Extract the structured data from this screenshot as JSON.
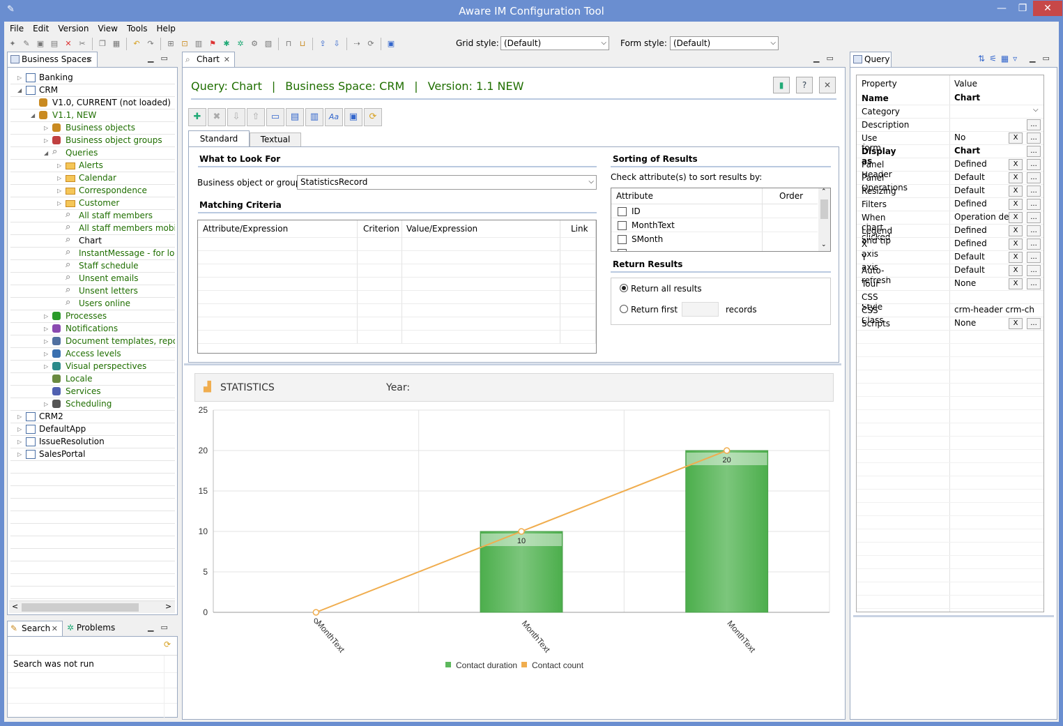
{
  "window": {
    "title": "Aware IM Configuration Tool"
  },
  "menu": [
    "File",
    "Edit",
    "Version",
    "View",
    "Tools",
    "Help"
  ],
  "toolbar": {
    "grid_style_label": "Grid style:",
    "grid_style_value": "(Default)",
    "form_style_label": "Form style:",
    "form_style_value": "(Default)"
  },
  "left_panel": {
    "tab": "Business Spaces",
    "tree": [
      {
        "label": "Banking",
        "level": 0,
        "tw": "▷",
        "green": false,
        "icon": "space"
      },
      {
        "label": "CRM",
        "level": 0,
        "tw": "◢",
        "green": false,
        "icon": "space"
      },
      {
        "label": "V1.0, CURRENT (not loaded)",
        "level": 1,
        "tw": "",
        "green": false,
        "icon": "version"
      },
      {
        "label": "V1.1, NEW",
        "level": 1,
        "tw": "◢",
        "green": true,
        "icon": "version"
      },
      {
        "label": "Business objects",
        "level": 2,
        "tw": "▷",
        "green": true,
        "icon": "bo"
      },
      {
        "label": "Business object groups",
        "level": 2,
        "tw": "▷",
        "green": true,
        "icon": "bog"
      },
      {
        "label": "Queries",
        "level": 2,
        "tw": "◢",
        "green": true,
        "icon": "query"
      },
      {
        "label": "Alerts",
        "level": 3,
        "tw": "▷",
        "green": true,
        "icon": "folder"
      },
      {
        "label": "Calendar",
        "level": 3,
        "tw": "▷",
        "green": true,
        "icon": "folder"
      },
      {
        "label": "Correspondence",
        "level": 3,
        "tw": "▷",
        "green": true,
        "icon": "folder"
      },
      {
        "label": "Customer",
        "level": 3,
        "tw": "▷",
        "green": true,
        "icon": "folder"
      },
      {
        "label": "All staff members",
        "level": 3,
        "tw": "",
        "green": true,
        "icon": "query"
      },
      {
        "label": "All staff members mobile",
        "level": 3,
        "tw": "",
        "green": true,
        "icon": "query"
      },
      {
        "label": "Chart",
        "level": 3,
        "tw": "",
        "green": false,
        "icon": "query"
      },
      {
        "label": "InstantMessage - for logged",
        "level": 3,
        "tw": "",
        "green": true,
        "icon": "query"
      },
      {
        "label": "Staff schedule",
        "level": 3,
        "tw": "",
        "green": true,
        "icon": "query"
      },
      {
        "label": "Unsent emails",
        "level": 3,
        "tw": "",
        "green": true,
        "icon": "query"
      },
      {
        "label": "Unsent letters",
        "level": 3,
        "tw": "",
        "green": true,
        "icon": "query"
      },
      {
        "label": "Users online",
        "level": 3,
        "tw": "",
        "green": true,
        "icon": "query"
      },
      {
        "label": "Processes",
        "level": 2,
        "tw": "▷",
        "green": true,
        "icon": "process"
      },
      {
        "label": "Notifications",
        "level": 2,
        "tw": "▷",
        "green": true,
        "icon": "notif"
      },
      {
        "label": "Document templates, reports",
        "level": 2,
        "tw": "▷",
        "green": true,
        "icon": "doc"
      },
      {
        "label": "Access levels",
        "level": 2,
        "tw": "▷",
        "green": true,
        "icon": "access"
      },
      {
        "label": "Visual perspectives",
        "level": 2,
        "tw": "▷",
        "green": true,
        "icon": "visual"
      },
      {
        "label": "Locale",
        "level": 2,
        "tw": "",
        "green": true,
        "icon": "locale"
      },
      {
        "label": "Services",
        "level": 2,
        "tw": "",
        "green": true,
        "icon": "services"
      },
      {
        "label": "Scheduling",
        "level": 2,
        "tw": "▷",
        "green": true,
        "icon": "sched"
      },
      {
        "label": "CRM2",
        "level": 0,
        "tw": "▷",
        "green": false,
        "icon": "space"
      },
      {
        "label": "DefaultApp",
        "level": 0,
        "tw": "▷",
        "green": false,
        "icon": "space"
      },
      {
        "label": "IssueResolution",
        "level": 0,
        "tw": "▷",
        "green": false,
        "icon": "space"
      },
      {
        "label": "SalesPortal",
        "level": 0,
        "tw": "▷",
        "green": false,
        "icon": "space"
      }
    ]
  },
  "search_panel": {
    "tab_search": "Search",
    "tab_problems": "Problems",
    "message": "Search was not run"
  },
  "editor": {
    "tab": "Chart",
    "header_query": "Query: Chart",
    "header_sep1": "|",
    "header_space": "Business Space: CRM",
    "header_sep2": "|",
    "header_version": "Version: 1.1 NEW",
    "view_tabs": [
      "Standard view",
      "Textual view"
    ],
    "what_to_look_for": "What to Look For",
    "bo_label": "Business object or group:",
    "bo_value": "StatisticsRecord",
    "matching_criteria": "Matching Criteria",
    "criteria_cols": [
      "Attribute/Expression",
      "Criterion",
      "Value/Expression",
      "Link"
    ],
    "sorting_title": "Sorting of Results",
    "sorting_hint": "Check attribute(s) to sort results by:",
    "sort_cols": [
      "Attribute",
      "Order"
    ],
    "sort_attrs": [
      "ID",
      "MonthText",
      "SMonth"
    ],
    "return_title": "Return Results",
    "return_all": "Return all results",
    "return_first": "Return first",
    "records": "records"
  },
  "preview": {
    "title": "STATISTICS",
    "year_label": "Year:"
  },
  "chart_data": {
    "type": "bar",
    "categories": [
      "MonthText",
      "MonthText",
      "MonthText"
    ],
    "series": [
      {
        "name": "Contact duration",
        "type": "bar",
        "values": [
          0,
          10,
          20
        ],
        "color": "#5cb85c"
      },
      {
        "name": "Contact count",
        "type": "line",
        "values": [
          0,
          10,
          20
        ],
        "color": "#f0ad4e"
      }
    ],
    "data_labels": [
      "0",
      "10",
      "20"
    ],
    "ylim": [
      0,
      25
    ],
    "yticks": [
      "0",
      "5",
      "10",
      "15",
      "20",
      "25"
    ],
    "legend": "bottom",
    "grid": true
  },
  "query_panel": {
    "tab": "Query",
    "cols": [
      "Property",
      "Value"
    ],
    "props": [
      {
        "name": "Name",
        "value": "Chart",
        "bold": true,
        "x": false,
        "dots": false,
        "dd": false
      },
      {
        "name": "Category",
        "value": "",
        "bold": false,
        "x": false,
        "dots": false,
        "dd": true
      },
      {
        "name": "Description",
        "value": "",
        "bold": false,
        "x": false,
        "dots": true,
        "dd": false
      },
      {
        "name": "Use form",
        "value": "No",
        "bold": false,
        "x": true,
        "dots": true,
        "dd": false
      },
      {
        "name": "Display as",
        "value": "Chart",
        "bold": true,
        "x": false,
        "dots": true,
        "dd": false
      },
      {
        "name": "Panel Header",
        "value": "Defined",
        "bold": false,
        "x": true,
        "dots": true,
        "dd": false
      },
      {
        "name": "Panel Operations",
        "value": "Default",
        "bold": false,
        "x": true,
        "dots": true,
        "dd": false
      },
      {
        "name": "Resizing",
        "value": "Default",
        "bold": false,
        "x": true,
        "dots": true,
        "dd": false
      },
      {
        "name": "Filters",
        "value": "Defined",
        "bold": false,
        "x": true,
        "dots": true,
        "dd": false
      },
      {
        "name": "When chart clicked",
        "value": "Operation defi",
        "bold": false,
        "x": true,
        "dots": true,
        "dd": false
      },
      {
        "name": "Legend and tip",
        "value": "Defined",
        "bold": false,
        "x": true,
        "dots": true,
        "dd": false
      },
      {
        "name": "X axis",
        "value": "Defined",
        "bold": false,
        "x": true,
        "dots": true,
        "dd": false
      },
      {
        "name": "Y axis",
        "value": "Default",
        "bold": false,
        "x": true,
        "dots": true,
        "dd": false
      },
      {
        "name": "Auto-refresh",
        "value": "Default",
        "bold": false,
        "x": true,
        "dots": true,
        "dd": false
      },
      {
        "name": "Tour",
        "value": "None",
        "bold": false,
        "x": true,
        "dots": true,
        "dd": false
      },
      {
        "name": "CSS Style",
        "value": "",
        "bold": false,
        "x": false,
        "dots": false,
        "dd": false
      },
      {
        "name": "CSS Class",
        "value": "crm-header crm-chart",
        "bold": false,
        "x": false,
        "dots": false,
        "dd": false
      },
      {
        "name": "Scripts",
        "value": "None",
        "bold": false,
        "x": true,
        "dots": true,
        "dd": false
      }
    ]
  }
}
